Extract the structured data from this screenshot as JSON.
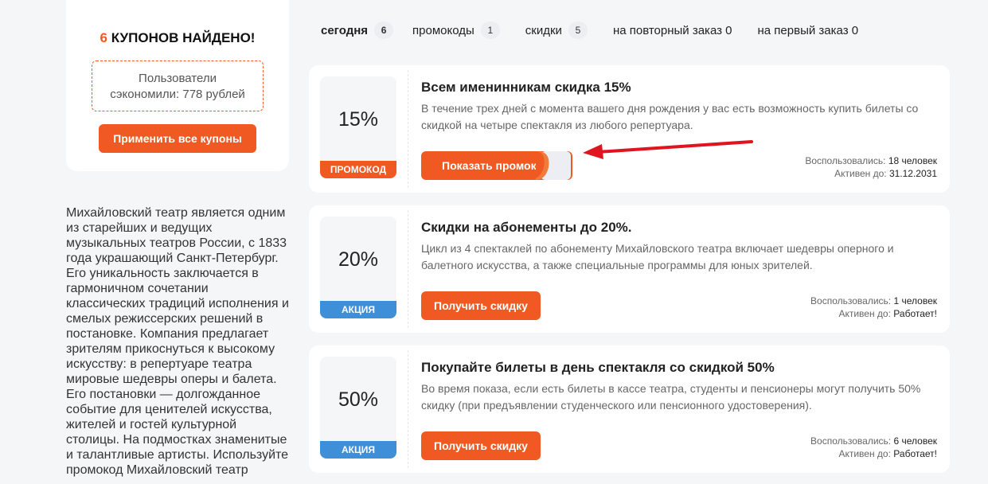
{
  "summary": {
    "count": "6",
    "found_text": "КУПОНОВ НАЙДЕНО!",
    "saved_line1": "Пользователи",
    "saved_line2": "сэкономили: 778 рублей",
    "apply_all_label": "Применить все купоны"
  },
  "about_text": "Михайловский театр является одним из старейших и ведущих музыкальных театров России, с 1833 года украшающий Санкт-Петербург. Его уникальность заключается в гармоничном сочетании классических традиций исполнения и смелых режиссерских решений в постановке. Компания предлагает зрителям прикоснуться к высокому искусству: в репертуаре театра мировые шедевры оперы и балета. Его постановки — долгожданное событие для ценителей искусства, жителей и гостей культурной столицы. На подмостках знаменитые и талантливые артисты. Используйте промокод Михайловский театр",
  "tabs": [
    {
      "label": "сегодня",
      "count": "6"
    },
    {
      "label": "промокоды",
      "count": "1"
    },
    {
      "label": "скидки",
      "count": "5"
    },
    {
      "label": "на повторный заказ 0"
    },
    {
      "label": "на первый заказ 0"
    }
  ],
  "coupons": [
    {
      "percent": "15%",
      "tag": "ПРОМОКОД",
      "title": "Всем именинникам скидка 15%",
      "description": "В течение трех дней с момента вашего дня рождения у вас есть возможность купить билеты со скидкой на четыре спектакля из любого репертуара.",
      "button": "Показать промокод",
      "used_label": "Воспользовались:",
      "used_value": "18 человек",
      "active_label": "Активен до:",
      "active_value": "31.12.2031"
    },
    {
      "percent": "20%",
      "tag": "АКЦИЯ",
      "title": "Скидки на абонементы до 20%.",
      "description": "Цикл из 4 спектаклей по абонементу Михайловского театра включает шедевры оперного и балетного искусства, а также специальные программы для юных зрителей.",
      "button": "Получить скидку",
      "used_label": "Воспользовались:",
      "used_value": "1 человек",
      "active_label": "Активен до:",
      "active_value": "Работает!"
    },
    {
      "percent": "50%",
      "tag": "АКЦИЯ",
      "title": "Покупайте билеты в день спектакля со скидкой 50%",
      "description": "Во время показа, если есть билеты в кассе театра, студенты и пенсионеры могут получить 50% скидку (при предъявлении студенческого или пенсионного удостоверения).",
      "button": "Получить скидку",
      "used_label": "Воспользовались:",
      "used_value": "6 человек",
      "active_label": "Активен до:",
      "active_value": "Работает!"
    }
  ],
  "colors": {
    "accent": "#f05a22",
    "sale_tag": "#3e8fd8",
    "arrow": "#e0141e"
  }
}
